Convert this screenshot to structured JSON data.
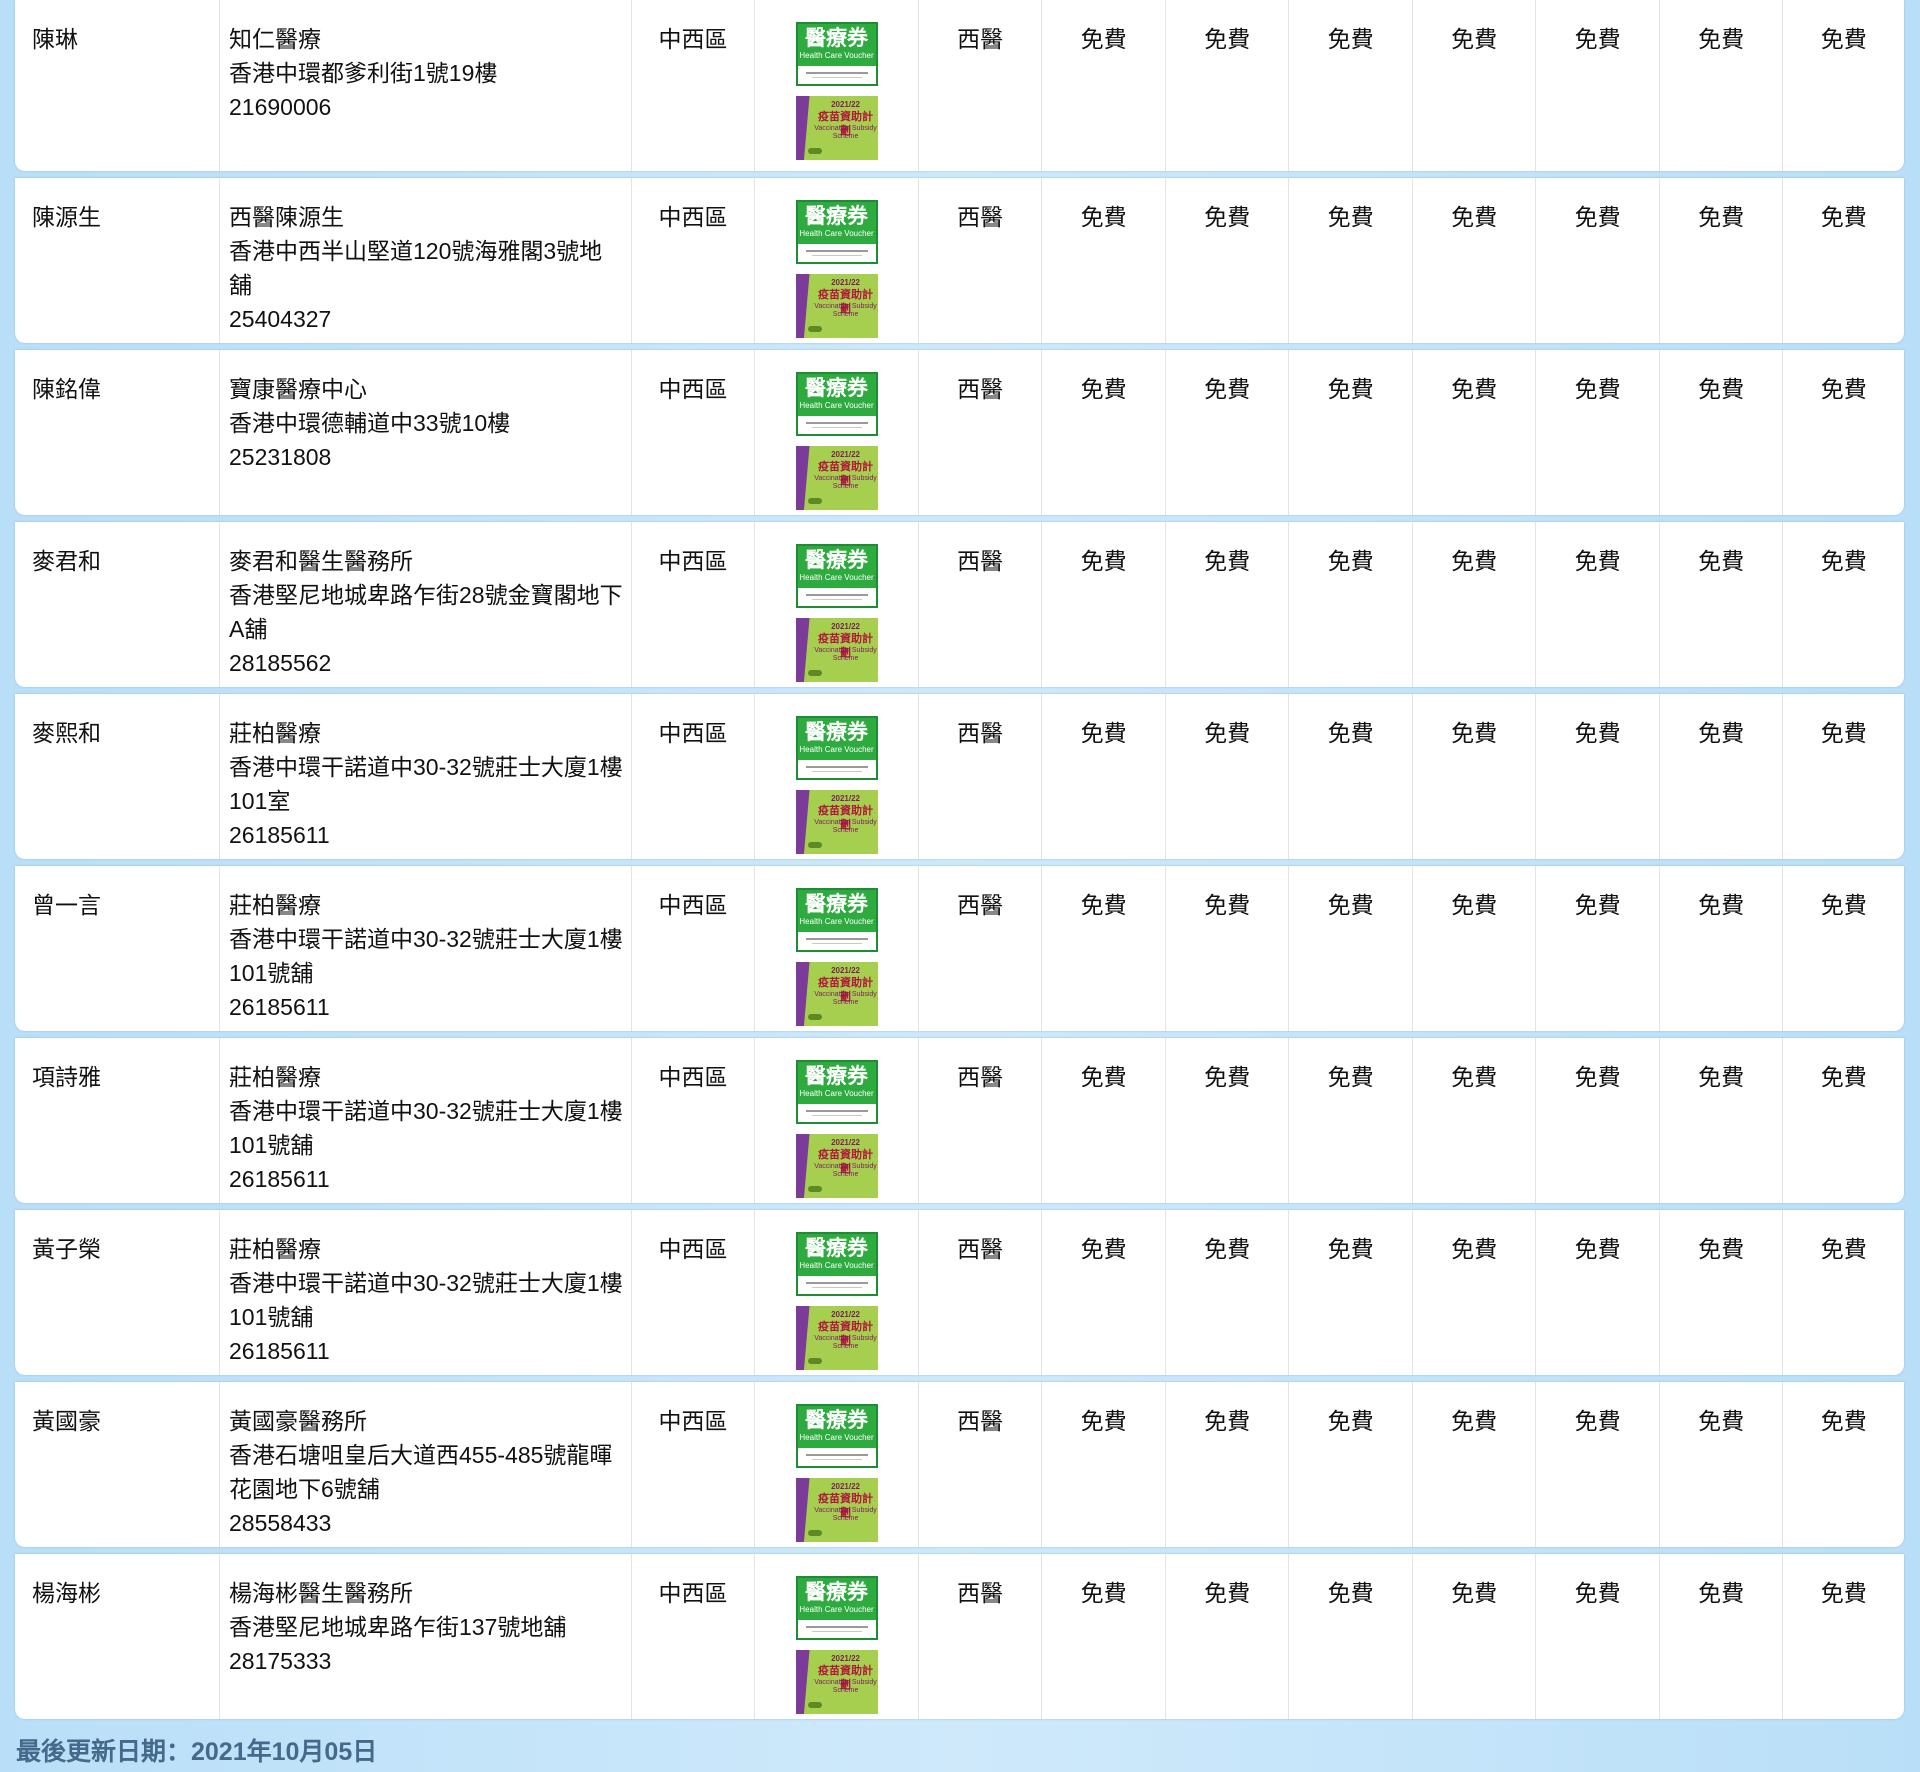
{
  "badges": {
    "hcv_title": "醫療券",
    "hcv_en": "Health Care Voucher",
    "vss_year": "2021/22",
    "vss_cn": "疫苗資助計劃",
    "vss_en": "Vaccination Subsidy Scheme"
  },
  "rows": [
    {
      "name": "陳琳",
      "clinic_lines": [
        "知仁醫療",
        "香港中環都爹利街1號19樓"
      ],
      "phone": "21690006",
      "district": "中西區",
      "type": "西醫",
      "fees": [
        "免費",
        "免費",
        "免費",
        "免費",
        "免費",
        "免費",
        "免費"
      ]
    },
    {
      "name": "陳源生",
      "clinic_lines": [
        "西醫陳源生",
        "香港中西半山堅道120號海雅閣3號地舖"
      ],
      "phone": "25404327",
      "district": "中西區",
      "type": "西醫",
      "fees": [
        "免費",
        "免費",
        "免費",
        "免費",
        "免費",
        "免費",
        "免費"
      ]
    },
    {
      "name": "陳銘偉",
      "clinic_lines": [
        "寶康醫療中心",
        "香港中環德輔道中33號10樓"
      ],
      "phone": "25231808",
      "district": "中西區",
      "type": "西醫",
      "fees": [
        "免費",
        "免費",
        "免費",
        "免費",
        "免費",
        "免費",
        "免費"
      ]
    },
    {
      "name": "麥君和",
      "clinic_lines": [
        "麥君和醫生醫務所",
        "香港堅尼地城卑路乍街28號金寶閣地下",
        "A舖"
      ],
      "phone": "28185562",
      "district": "中西區",
      "type": "西醫",
      "fees": [
        "免費",
        "免費",
        "免費",
        "免費",
        "免費",
        "免費",
        "免費"
      ]
    },
    {
      "name": "麥熙和",
      "clinic_lines": [
        "莊柏醫療",
        "香港中環干諾道中30-32號莊士大廈1樓",
        "101室"
      ],
      "phone": "26185611",
      "district": "中西區",
      "type": "西醫",
      "fees": [
        "免費",
        "免費",
        "免費",
        "免費",
        "免費",
        "免費",
        "免費"
      ]
    },
    {
      "name": "曾一言",
      "clinic_lines": [
        "莊柏醫療",
        "香港中環干諾道中30-32號莊士大廈1樓",
        "101號舖"
      ],
      "phone": "26185611",
      "district": "中西區",
      "type": "西醫",
      "fees": [
        "免費",
        "免費",
        "免費",
        "免費",
        "免費",
        "免費",
        "免費"
      ]
    },
    {
      "name": "項詩雅",
      "clinic_lines": [
        "莊柏醫療",
        "香港中環干諾道中30-32號莊士大廈1樓",
        "101號舖"
      ],
      "phone": "26185611",
      "district": "中西區",
      "type": "西醫",
      "fees": [
        "免費",
        "免費",
        "免費",
        "免費",
        "免費",
        "免費",
        "免費"
      ]
    },
    {
      "name": "黃子榮",
      "clinic_lines": [
        "莊柏醫療",
        "香港中環干諾道中30-32號莊士大廈1樓",
        "101號舖"
      ],
      "phone": "26185611",
      "district": "中西區",
      "type": "西醫",
      "fees": [
        "免費",
        "免費",
        "免費",
        "免費",
        "免費",
        "免費",
        "免費"
      ]
    },
    {
      "name": "黃國豪",
      "clinic_lines": [
        "黃國豪醫務所",
        "香港石塘咀皇后大道西455-485號龍暉",
        "花園地下6號舖"
      ],
      "phone": "28558433",
      "district": "中西區",
      "type": "西醫",
      "fees": [
        "免費",
        "免費",
        "免費",
        "免費",
        "免費",
        "免費",
        "免費"
      ]
    },
    {
      "name": "楊海彬",
      "clinic_lines": [
        "楊海彬醫生醫務所",
        "香港堅尼地城卑路乍街137號地舖"
      ],
      "phone": "28175333",
      "district": "中西區",
      "type": "西醫",
      "fees": [
        "免費",
        "免費",
        "免費",
        "免費",
        "免費",
        "免費",
        "免費"
      ]
    }
  ],
  "footer": {
    "last_updated": "最後更新日期：2021年10月05日"
  },
  "colors": {
    "background": "#c4e4f9",
    "voucher_green": "#2eab3f",
    "vaccine_green": "#a7cf4f",
    "vaccine_purple": "#7b3b98",
    "footer_text": "#44698a"
  }
}
